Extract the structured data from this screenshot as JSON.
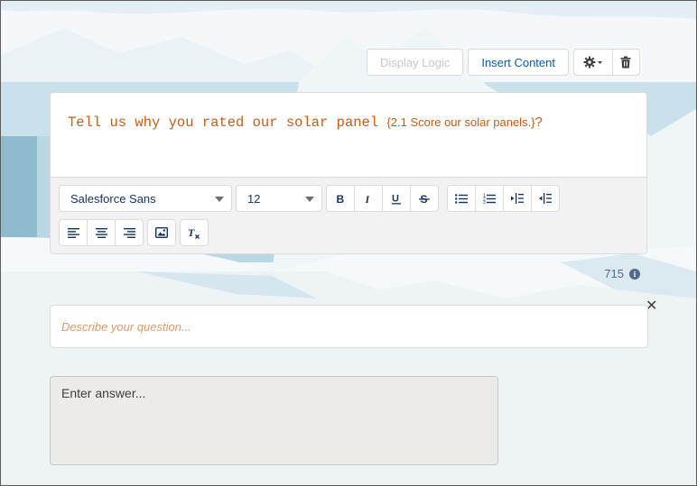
{
  "top_toolbar": {
    "display_logic_label": "Display Logic",
    "insert_content_label": "Insert Content",
    "settings_icon": "gear-icon",
    "delete_icon": "trash-icon"
  },
  "question": {
    "text": "Tell us why you rated our solar panel ",
    "piped_text": "{2.1 Score our solar panels.}",
    "suffix": "?"
  },
  "rte_toolbar": {
    "font_family": "Salesforce Sans",
    "font_size": "12",
    "format_icons": [
      "bold-icon",
      "italic-icon",
      "underline-icon",
      "strikethrough-icon"
    ],
    "list_icons": [
      "bulleted-list-icon",
      "numbered-list-icon",
      "indent-icon",
      "outdent-icon"
    ],
    "align_icons": [
      "align-left-icon",
      "align-center-icon",
      "align-right-icon"
    ],
    "image_icon": "image-icon",
    "clear_format_icon": "remove-formatting-icon"
  },
  "char_count": "715",
  "description": {
    "placeholder": "Describe your question..."
  },
  "answer": {
    "placeholder": "Enter answer..."
  },
  "colors": {
    "question_text": "#c65d15",
    "link_blue": "#0b5cab",
    "toolbar_bg": "#f3f2f2",
    "answer_bg": "#ecebea"
  }
}
